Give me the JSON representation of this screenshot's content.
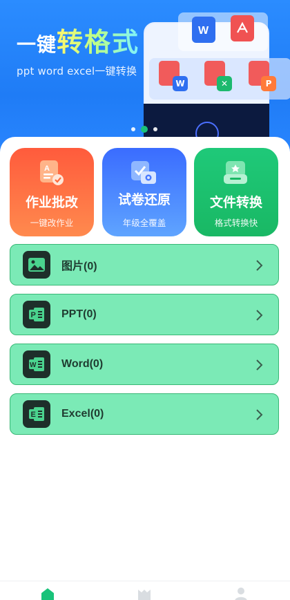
{
  "banner": {
    "title_prefix": "一键",
    "title_highlight": "转格式",
    "subtitle": "ppt word excel一键转换"
  },
  "features": [
    {
      "title": "作业批改",
      "subtitle": "一键改作业",
      "icon": "homework-check-icon"
    },
    {
      "title": "试卷还原",
      "subtitle": "年级全覆盖",
      "icon": "exam-restore-icon"
    },
    {
      "title": "文件转换",
      "subtitle": "格式转换快",
      "icon": "file-convert-icon"
    }
  ],
  "file_rows": [
    {
      "label": "图片(0)",
      "icon": "image-icon"
    },
    {
      "label": "PPT(0)",
      "icon": "ppt-file-icon"
    },
    {
      "label": "Word(0)",
      "icon": "word-file-icon"
    },
    {
      "label": "Excel(0)",
      "icon": "excel-file-icon"
    }
  ],
  "carousel": {
    "count": 3,
    "active": 1
  },
  "colors": {
    "banner": "#2b8cff",
    "row_fill": "#7beab6",
    "row_border": "#38b775",
    "accent_green": "#19c27a"
  }
}
